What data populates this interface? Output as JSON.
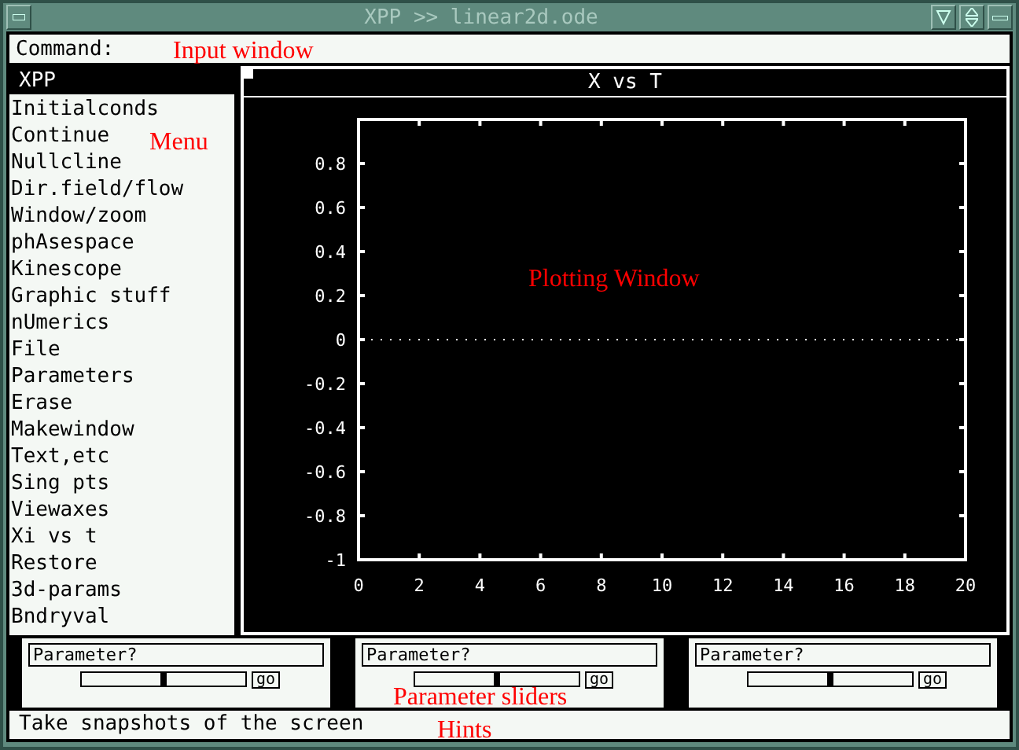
{
  "window": {
    "title": "XPP >> linear2d.ode"
  },
  "command": {
    "label": "Command:"
  },
  "menu": {
    "title": "XPP",
    "items": [
      {
        "label": "Initialconds"
      },
      {
        "label": "Continue"
      },
      {
        "label": "Nullcline"
      },
      {
        "label": "Dir.field/flow"
      },
      {
        "label": "Window/zoom"
      },
      {
        "label": "phAsespace"
      },
      {
        "label": "Kinescope"
      },
      {
        "label": "Graphic stuff"
      },
      {
        "label": "nUmerics"
      },
      {
        "label": "File"
      },
      {
        "label": "Parameters"
      },
      {
        "label": "Erase"
      },
      {
        "label": "Makewindow"
      },
      {
        "label": "Text,etc"
      },
      {
        "label": "Sing pts"
      },
      {
        "label": "Viewaxes"
      },
      {
        "label": "Xi vs t"
      },
      {
        "label": "Restore"
      },
      {
        "label": "3d-params"
      },
      {
        "label": "Bndryval"
      }
    ]
  },
  "plot": {
    "title": "X vs T",
    "chart_data": {
      "type": "line",
      "xlim": [
        0,
        20
      ],
      "ylim": [
        -1,
        1
      ],
      "xticks": [
        0,
        2,
        4,
        6,
        8,
        10,
        12,
        14,
        16,
        18,
        20
      ],
      "yticks": [
        {
          "value": 0.8,
          "label": "0.8"
        },
        {
          "value": 0.6,
          "label": "0.6"
        },
        {
          "value": 0.4,
          "label": "0.4"
        },
        {
          "value": 0.2,
          "label": "0.2"
        },
        {
          "value": 0,
          "label": "0"
        },
        {
          "value": -0.2,
          "label": "-0.2"
        },
        {
          "value": -0.4,
          "label": "-0.4"
        },
        {
          "value": -0.6,
          "label": "-0.6"
        },
        {
          "value": -0.8,
          "label": "-0.8"
        },
        {
          "value": -1,
          "label": "-1"
        }
      ]
    }
  },
  "sliders": [
    {
      "placeholder": "Parameter?",
      "level": 0.5,
      "button": "go"
    },
    {
      "placeholder": "Parameter?",
      "level": 0.5,
      "button": "go"
    },
    {
      "placeholder": "Parameter?",
      "level": 0.5,
      "button": "go"
    }
  ],
  "hint": "Take snapshots of the screen",
  "annotations": [
    {
      "text": "Input window",
      "kind": "input"
    },
    {
      "text": "Menu",
      "kind": "menu"
    },
    {
      "text": "Plotting Window",
      "kind": "plot"
    },
    {
      "text": "Parameter sliders",
      "kind": "sliders"
    },
    {
      "text": "Hints",
      "kind": "hints"
    }
  ]
}
